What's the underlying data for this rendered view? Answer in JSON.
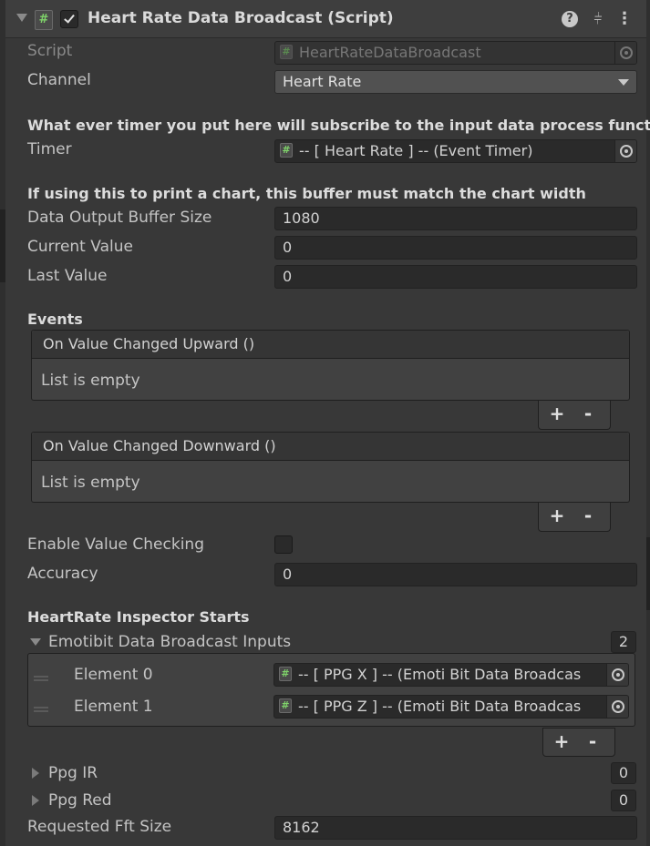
{
  "component": {
    "title": "Heart Rate Data Broadcast (Script)",
    "enabled": true,
    "icons": [
      "help-icon",
      "preset-icon",
      "menu-icon"
    ]
  },
  "fields": {
    "script": {
      "label": "Script",
      "value": "HeartRateDataBroadcast"
    },
    "channel": {
      "label": "Channel",
      "value": "Heart Rate"
    },
    "timer_note": "What ever timer you put here will subscribe to the input data process functior",
    "timer": {
      "label": "Timer",
      "value": "-- [ Heart Rate ] -- (Event Timer)"
    },
    "buffer_note": "If using this to print a chart, this buffer must match the chart width",
    "buffer_size": {
      "label": "Data Output Buffer Size",
      "value": "1080"
    },
    "current_value": {
      "label": "Current Value",
      "value": "0"
    },
    "last_value": {
      "label": "Last Value",
      "value": "0"
    }
  },
  "events": {
    "heading": "Events",
    "upward": {
      "title": "On Value Changed Upward ()",
      "empty": "List is empty"
    },
    "downward": {
      "title": "On Value Changed Downward ()",
      "empty": "List is empty"
    },
    "plus": "+",
    "minus": "-"
  },
  "checking": {
    "enable_label": "Enable Value Checking",
    "enabled": false,
    "accuracy_label": "Accuracy",
    "accuracy_value": "0"
  },
  "inspector": {
    "heading": "HeartRate Inspector Starts",
    "inputs_label": "Emotibit Data Broadcast Inputs",
    "inputs_count": "2",
    "elements": [
      {
        "label": "Element 0",
        "value": "-- [ PPG X ] --  (Emoti Bit Data Broadcas"
      },
      {
        "label": "Element 1",
        "value": "-- [ PPG Z ] -- (Emoti Bit Data Broadcas"
      }
    ],
    "ppg_ir": {
      "label": "Ppg IR",
      "count": "0"
    },
    "ppg_red": {
      "label": "Ppg Red",
      "count": "0"
    },
    "fft": {
      "label": "Requested Fft Size",
      "value": "8162"
    }
  },
  "glyphs": {
    "script_icon": "#",
    "help": "?",
    "preset": "⫩",
    "menu": "⋮"
  },
  "colors": {
    "background": "#383838",
    "field": "#2a2a2a",
    "script_icon_green": "#7fd36a"
  }
}
